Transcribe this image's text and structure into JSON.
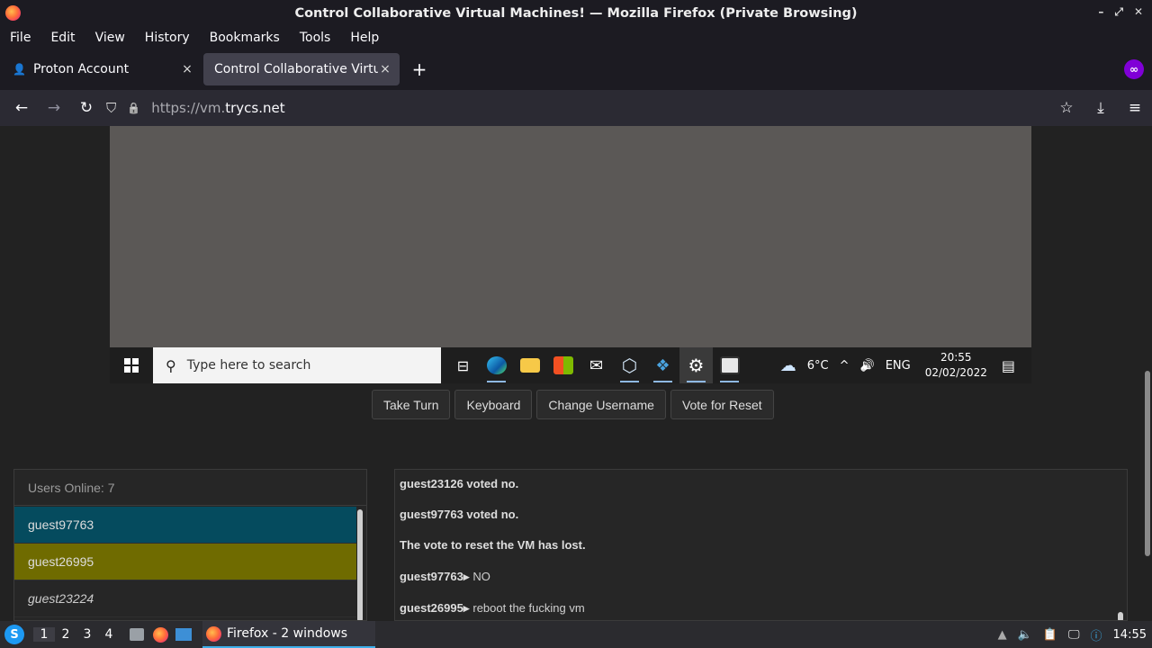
{
  "window": {
    "title": "Control Collaborative Virtual Machines! — Mozilla Firefox (Private Browsing)",
    "controls": [
      "–",
      "⤢",
      "✕"
    ]
  },
  "menu": [
    "File",
    "Edit",
    "View",
    "History",
    "Bookmarks",
    "Tools",
    "Help"
  ],
  "tabs": [
    {
      "label": "Proton Account",
      "close": "×"
    },
    {
      "label": "Control Collaborative Virtual",
      "close": "×"
    }
  ],
  "newtab": "+",
  "private_glyph": "∞",
  "nav": {
    "back": "←",
    "forward": "→",
    "reload": "↻",
    "shield": "⛉",
    "lock": "🔒",
    "url_scheme": "https://vm.",
    "url_host": "trycs.net",
    "bookmark": "☆",
    "download": "⤓",
    "menu": "≡"
  },
  "vm": {
    "search_placeholder": "Type here to search",
    "search_glyph": "⚲",
    "weather": "6°C",
    "weather_glyph": "☁",
    "tray_up": "^",
    "volume_glyph": "🔊",
    "lang": "ENG",
    "time": "20:55",
    "date": "02/02/2022",
    "notif_glyph": "▤"
  },
  "buttons": {
    "take_turn": "Take Turn",
    "keyboard": "Keyboard",
    "change_username": "Change Username",
    "vote_reset": "Vote for Reset"
  },
  "users": {
    "header": "Users Online: 7",
    "list": [
      "guest97763",
      "guest26995",
      "guest23224"
    ]
  },
  "chat": [
    {
      "user": "guest23126 voted no.",
      "msg": ""
    },
    {
      "user": "guest97763 voted no.",
      "msg": ""
    },
    {
      "user": "The vote to reset the VM has lost.",
      "msg": ""
    },
    {
      "user": "guest97763▸",
      "msg": "NO"
    },
    {
      "user": "guest26995▸",
      "msg": "reboot the fucking vm"
    }
  ],
  "taskbar": {
    "start_glyph": "S",
    "desktops": [
      "1",
      "2",
      "3",
      "4"
    ],
    "task_label": "Firefox - 2 windows",
    "clock": "14:55"
  }
}
